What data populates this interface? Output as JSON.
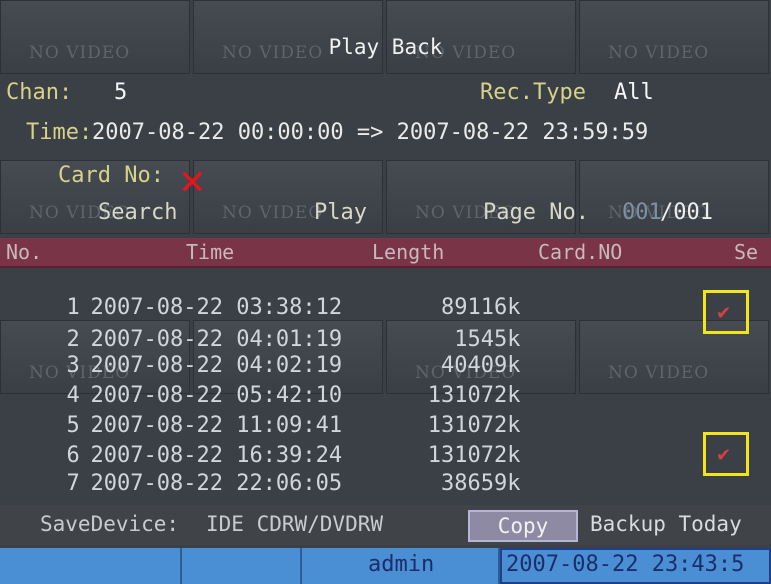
{
  "window": {
    "title": "Play Back"
  },
  "background": {
    "tile_label": "NO VIDEO"
  },
  "fields": {
    "chan_label": "Chan:",
    "chan_value": "5",
    "rec_type_label": "Rec.Type",
    "rec_type_value": "All",
    "time_label": "Time:",
    "time_range": "2007-08-22  00:00:00 => 2007-08-22  23:59:59",
    "card_label": "Card No:"
  },
  "buttons": {
    "search": "Search",
    "play": "Play",
    "page_label": "Page No.",
    "page_current": "001",
    "page_total": "/001",
    "copy": "Copy",
    "backup_today": "Backup Today"
  },
  "table": {
    "headers": [
      "No.",
      "Time",
      "Length",
      "Card.NO",
      "Se"
    ],
    "rows": [
      {
        "no": "1",
        "time": "2007-08-22 03:38:12",
        "length": "89116k",
        "selected": false
      },
      {
        "no": "2",
        "time": "2007-08-22 04:01:19",
        "length": "1545k",
        "selected": true
      },
      {
        "no": "3",
        "time": "2007-08-22 04:02:19",
        "length": "40409k",
        "selected": false
      },
      {
        "no": "4",
        "time": "2007-08-22 05:42:10",
        "length": "131072k",
        "selected": false
      },
      {
        "no": "5",
        "time": "2007-08-22 11:09:41",
        "length": "131072k",
        "selected": false
      },
      {
        "no": "6",
        "time": "2007-08-22 16:39:24",
        "length": "131072k",
        "selected": false
      },
      {
        "no": "7",
        "time": "2007-08-22 22:06:05",
        "length": "38659k",
        "selected": true
      }
    ]
  },
  "save_device": {
    "label": "SaveDevice:",
    "value": "IDE CDRW/DVDRW"
  },
  "status": {
    "user": "admin",
    "datetime": "2007-08-22 23:43:5"
  },
  "colors": {
    "header_bar": "#7a3447",
    "status_bar": "#4a8fd4",
    "selection_box": "#f3e51c",
    "x_mark": "#e8141a"
  },
  "icons": {
    "card_status": "red-x-icon",
    "select_mark": "check-icon"
  }
}
